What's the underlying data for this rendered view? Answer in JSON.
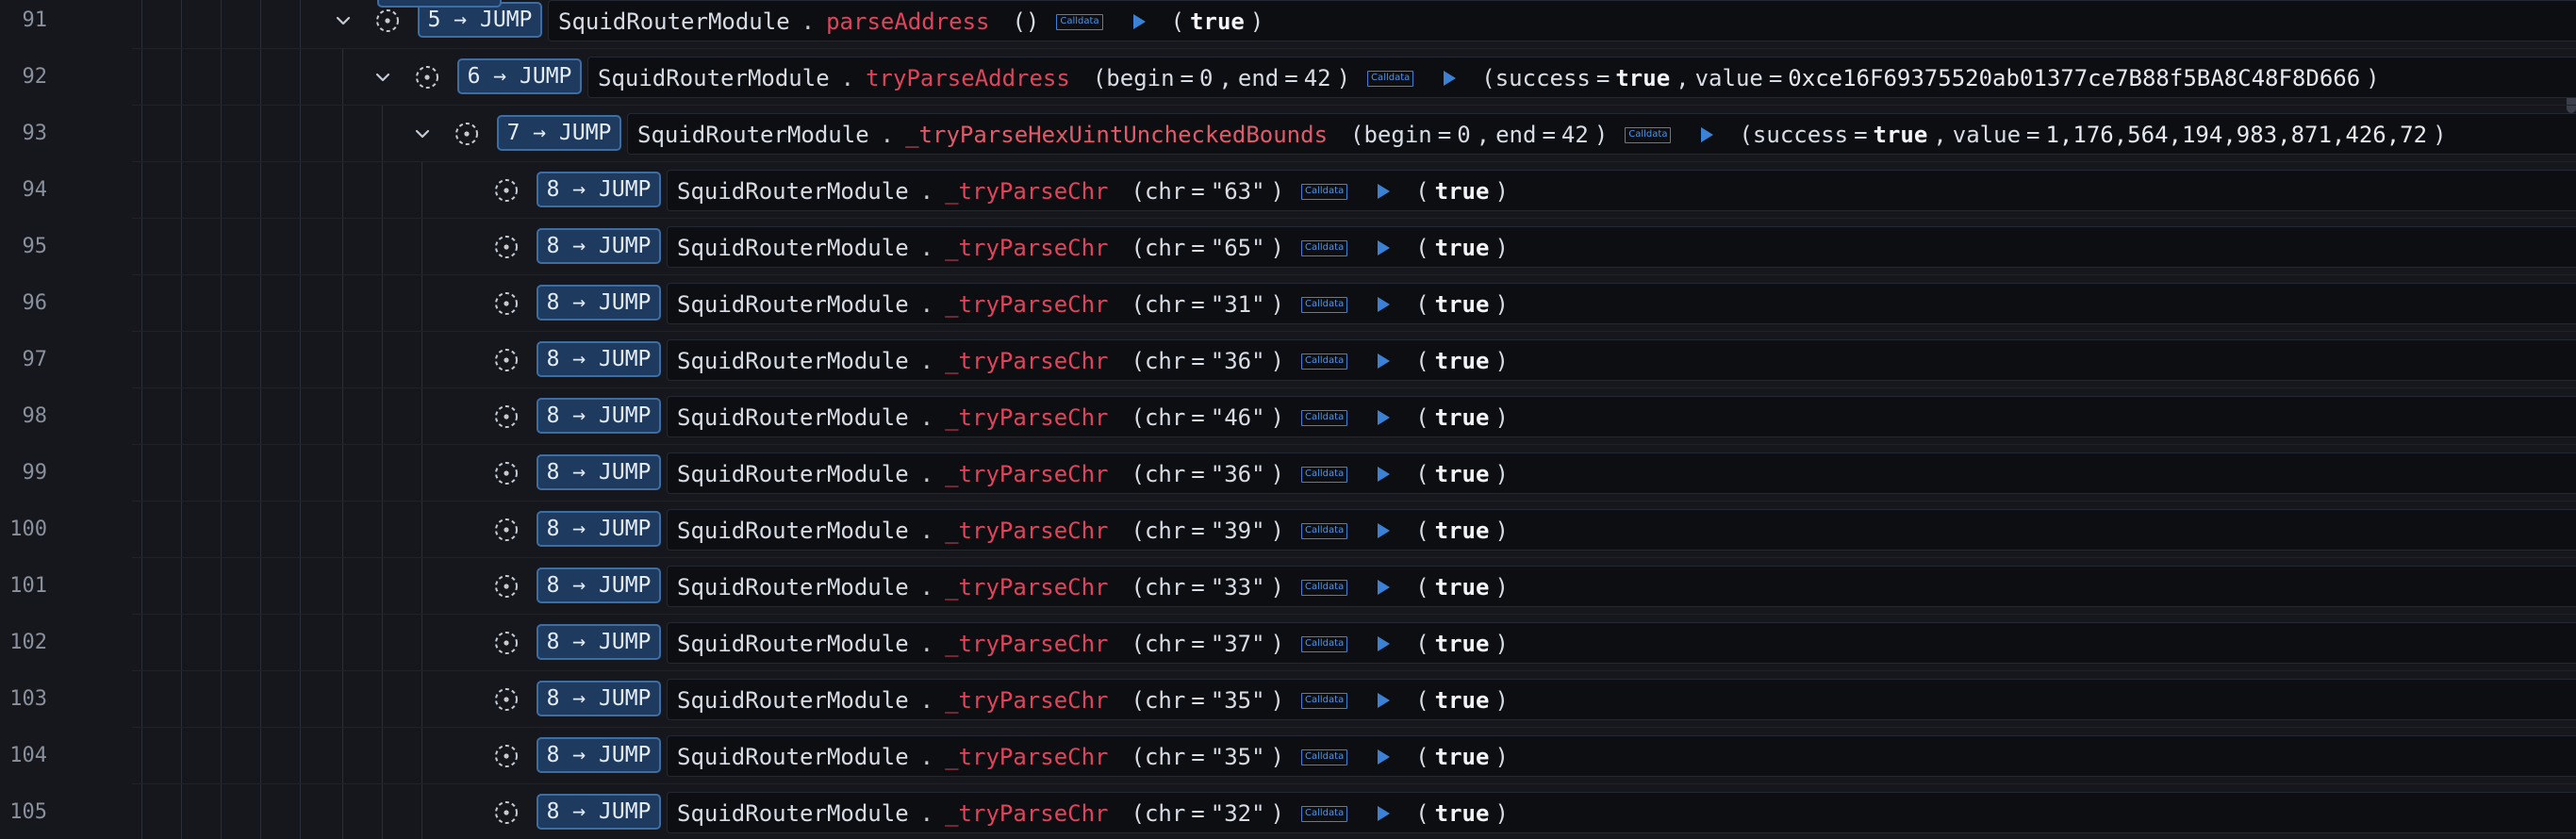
{
  "trace": {
    "calldata_label": "Calldata",
    "rows": [
      {
        "line": "91",
        "depth": "5",
        "jump_label": "5 → JUMP",
        "module": "SquidRouterModule",
        "fn": "parseAddress",
        "kind": "parseAddress",
        "result": "true"
      },
      {
        "line": "92",
        "depth": "6",
        "jump_label": "6 → JUMP",
        "module": "SquidRouterModule",
        "fn": "tryParseAddress",
        "kind": "range",
        "begin": "0",
        "end": "42",
        "success": "true",
        "value": "0xce16F69375520ab01377ce7B88f5BA8C48F8D666"
      },
      {
        "line": "93",
        "depth": "7",
        "jump_label": "7 → JUMP",
        "module": "SquidRouterModule",
        "fn": "_tryParseHexUintUncheckedBounds",
        "kind": "range",
        "begin": "0",
        "end": "42",
        "success": "true",
        "value": "1,176,564,194,983,871,426,72"
      },
      {
        "line": "94",
        "depth": "8",
        "jump_label": "8 → JUMP",
        "module": "SquidRouterModule",
        "fn": "_tryParseChr",
        "kind": "chr",
        "chr": "\"63\"",
        "result": "true"
      },
      {
        "line": "95",
        "depth": "8",
        "jump_label": "8 → JUMP",
        "module": "SquidRouterModule",
        "fn": "_tryParseChr",
        "kind": "chr",
        "chr": "\"65\"",
        "result": "true"
      },
      {
        "line": "96",
        "depth": "8",
        "jump_label": "8 → JUMP",
        "module": "SquidRouterModule",
        "fn": "_tryParseChr",
        "kind": "chr",
        "chr": "\"31\"",
        "result": "true"
      },
      {
        "line": "97",
        "depth": "8",
        "jump_label": "8 → JUMP",
        "module": "SquidRouterModule",
        "fn": "_tryParseChr",
        "kind": "chr",
        "chr": "\"36\"",
        "result": "true"
      },
      {
        "line": "98",
        "depth": "8",
        "jump_label": "8 → JUMP",
        "module": "SquidRouterModule",
        "fn": "_tryParseChr",
        "kind": "chr",
        "chr": "\"46\"",
        "result": "true"
      },
      {
        "line": "99",
        "depth": "8",
        "jump_label": "8 → JUMP",
        "module": "SquidRouterModule",
        "fn": "_tryParseChr",
        "kind": "chr",
        "chr": "\"36\"",
        "result": "true"
      },
      {
        "line": "100",
        "depth": "8",
        "jump_label": "8 → JUMP",
        "module": "SquidRouterModule",
        "fn": "_tryParseChr",
        "kind": "chr",
        "chr": "\"39\"",
        "result": "true"
      },
      {
        "line": "101",
        "depth": "8",
        "jump_label": "8 → JUMP",
        "module": "SquidRouterModule",
        "fn": "_tryParseChr",
        "kind": "chr",
        "chr": "\"33\"",
        "result": "true"
      },
      {
        "line": "102",
        "depth": "8",
        "jump_label": "8 → JUMP",
        "module": "SquidRouterModule",
        "fn": "_tryParseChr",
        "kind": "chr",
        "chr": "\"37\"",
        "result": "true"
      },
      {
        "line": "103",
        "depth": "8",
        "jump_label": "8 → JUMP",
        "module": "SquidRouterModule",
        "fn": "_tryParseChr",
        "kind": "chr",
        "chr": "\"35\"",
        "result": "true"
      },
      {
        "line": "104",
        "depth": "8",
        "jump_label": "8 → JUMP",
        "module": "SquidRouterModule",
        "fn": "_tryParseChr",
        "kind": "chr",
        "chr": "\"35\"",
        "result": "true"
      },
      {
        "line": "105",
        "depth": "8",
        "jump_label": "8 → JUMP",
        "module": "SquidRouterModule",
        "fn": "_tryParseChr",
        "kind": "chr",
        "chr": "\"32\"",
        "result": "true"
      }
    ],
    "labels": {
      "begin": "begin",
      "end": "end",
      "chr": "chr",
      "success": "success",
      "value": "value"
    },
    "colors": {
      "background": "#15171d",
      "badge_bg": "#1e3a5f",
      "badge_border": "#3d6ea3",
      "function_name": "#e0445c",
      "accent_blue": "#3b82d6"
    },
    "icons": {
      "expand": "chevron-down-icon",
      "status": "dashed-circle-icon",
      "play": "play-triangle-icon"
    }
  }
}
